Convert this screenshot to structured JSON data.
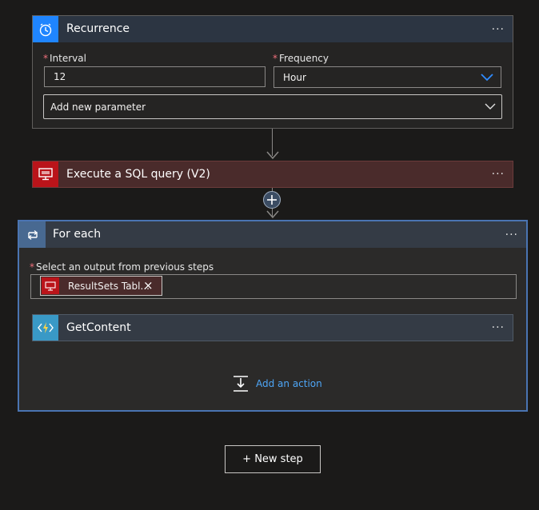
{
  "recurrence": {
    "title": "Recurrence",
    "menu": "···",
    "interval_label": "Interval",
    "interval_required": "*",
    "interval_value": "12",
    "frequency_label": "Frequency",
    "frequency_required": "*",
    "frequency_value": "Hour",
    "add_param_label": "Add new parameter",
    "icon": "clock-icon",
    "accent": "#1f85ff"
  },
  "sql": {
    "title": "Execute a SQL query (V2)",
    "menu": "···",
    "icon": "sql-monitor-icon",
    "accent": "#ba141a"
  },
  "insert": {
    "icon": "plus-circle-icon"
  },
  "foreach": {
    "title": "For each",
    "menu": "···",
    "select_label": "Select an output from previous steps",
    "select_required": "*",
    "token_label": "ResultSets Tabl...",
    "token_remove": "×",
    "icon": "loop-icon",
    "accent": "#486991"
  },
  "getcontent": {
    "title": "GetContent",
    "menu": "···",
    "icon": "function-icon",
    "accent": "#3999c6"
  },
  "add_action": {
    "label": "Add an action",
    "icon": "add-action-icon"
  },
  "new_step": {
    "label": "+ New step"
  }
}
